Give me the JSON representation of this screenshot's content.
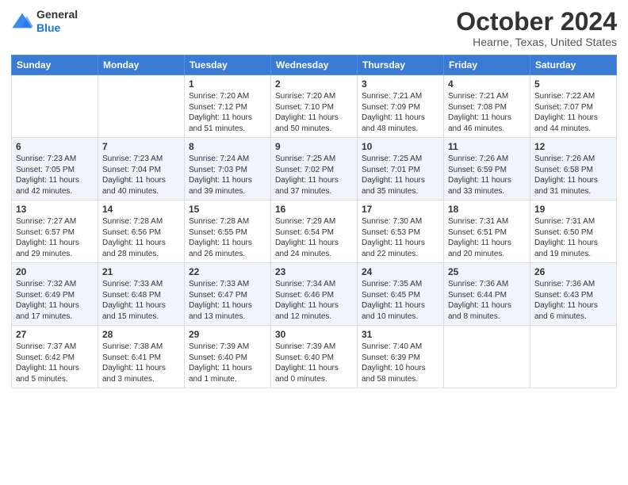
{
  "header": {
    "logo": {
      "general": "General",
      "blue": "Blue"
    },
    "title": "October 2024",
    "subtitle": "Hearne, Texas, United States"
  },
  "calendar": {
    "days_of_week": [
      "Sunday",
      "Monday",
      "Tuesday",
      "Wednesday",
      "Thursday",
      "Friday",
      "Saturday"
    ],
    "weeks": [
      [
        {
          "day": "",
          "sunrise": "",
          "sunset": "",
          "daylight": ""
        },
        {
          "day": "",
          "sunrise": "",
          "sunset": "",
          "daylight": ""
        },
        {
          "day": "1",
          "sunrise": "Sunrise: 7:20 AM",
          "sunset": "Sunset: 7:12 PM",
          "daylight": "Daylight: 11 hours and 51 minutes."
        },
        {
          "day": "2",
          "sunrise": "Sunrise: 7:20 AM",
          "sunset": "Sunset: 7:10 PM",
          "daylight": "Daylight: 11 hours and 50 minutes."
        },
        {
          "day": "3",
          "sunrise": "Sunrise: 7:21 AM",
          "sunset": "Sunset: 7:09 PM",
          "daylight": "Daylight: 11 hours and 48 minutes."
        },
        {
          "day": "4",
          "sunrise": "Sunrise: 7:21 AM",
          "sunset": "Sunset: 7:08 PM",
          "daylight": "Daylight: 11 hours and 46 minutes."
        },
        {
          "day": "5",
          "sunrise": "Sunrise: 7:22 AM",
          "sunset": "Sunset: 7:07 PM",
          "daylight": "Daylight: 11 hours and 44 minutes."
        }
      ],
      [
        {
          "day": "6",
          "sunrise": "Sunrise: 7:23 AM",
          "sunset": "Sunset: 7:05 PM",
          "daylight": "Daylight: 11 hours and 42 minutes."
        },
        {
          "day": "7",
          "sunrise": "Sunrise: 7:23 AM",
          "sunset": "Sunset: 7:04 PM",
          "daylight": "Daylight: 11 hours and 40 minutes."
        },
        {
          "day": "8",
          "sunrise": "Sunrise: 7:24 AM",
          "sunset": "Sunset: 7:03 PM",
          "daylight": "Daylight: 11 hours and 39 minutes."
        },
        {
          "day": "9",
          "sunrise": "Sunrise: 7:25 AM",
          "sunset": "Sunset: 7:02 PM",
          "daylight": "Daylight: 11 hours and 37 minutes."
        },
        {
          "day": "10",
          "sunrise": "Sunrise: 7:25 AM",
          "sunset": "Sunset: 7:01 PM",
          "daylight": "Daylight: 11 hours and 35 minutes."
        },
        {
          "day": "11",
          "sunrise": "Sunrise: 7:26 AM",
          "sunset": "Sunset: 6:59 PM",
          "daylight": "Daylight: 11 hours and 33 minutes."
        },
        {
          "day": "12",
          "sunrise": "Sunrise: 7:26 AM",
          "sunset": "Sunset: 6:58 PM",
          "daylight": "Daylight: 11 hours and 31 minutes."
        }
      ],
      [
        {
          "day": "13",
          "sunrise": "Sunrise: 7:27 AM",
          "sunset": "Sunset: 6:57 PM",
          "daylight": "Daylight: 11 hours and 29 minutes."
        },
        {
          "day": "14",
          "sunrise": "Sunrise: 7:28 AM",
          "sunset": "Sunset: 6:56 PM",
          "daylight": "Daylight: 11 hours and 28 minutes."
        },
        {
          "day": "15",
          "sunrise": "Sunrise: 7:28 AM",
          "sunset": "Sunset: 6:55 PM",
          "daylight": "Daylight: 11 hours and 26 minutes."
        },
        {
          "day": "16",
          "sunrise": "Sunrise: 7:29 AM",
          "sunset": "Sunset: 6:54 PM",
          "daylight": "Daylight: 11 hours and 24 minutes."
        },
        {
          "day": "17",
          "sunrise": "Sunrise: 7:30 AM",
          "sunset": "Sunset: 6:53 PM",
          "daylight": "Daylight: 11 hours and 22 minutes."
        },
        {
          "day": "18",
          "sunrise": "Sunrise: 7:31 AM",
          "sunset": "Sunset: 6:51 PM",
          "daylight": "Daylight: 11 hours and 20 minutes."
        },
        {
          "day": "19",
          "sunrise": "Sunrise: 7:31 AM",
          "sunset": "Sunset: 6:50 PM",
          "daylight": "Daylight: 11 hours and 19 minutes."
        }
      ],
      [
        {
          "day": "20",
          "sunrise": "Sunrise: 7:32 AM",
          "sunset": "Sunset: 6:49 PM",
          "daylight": "Daylight: 11 hours and 17 minutes."
        },
        {
          "day": "21",
          "sunrise": "Sunrise: 7:33 AM",
          "sunset": "Sunset: 6:48 PM",
          "daylight": "Daylight: 11 hours and 15 minutes."
        },
        {
          "day": "22",
          "sunrise": "Sunrise: 7:33 AM",
          "sunset": "Sunset: 6:47 PM",
          "daylight": "Daylight: 11 hours and 13 minutes."
        },
        {
          "day": "23",
          "sunrise": "Sunrise: 7:34 AM",
          "sunset": "Sunset: 6:46 PM",
          "daylight": "Daylight: 11 hours and 12 minutes."
        },
        {
          "day": "24",
          "sunrise": "Sunrise: 7:35 AM",
          "sunset": "Sunset: 6:45 PM",
          "daylight": "Daylight: 11 hours and 10 minutes."
        },
        {
          "day": "25",
          "sunrise": "Sunrise: 7:36 AM",
          "sunset": "Sunset: 6:44 PM",
          "daylight": "Daylight: 11 hours and 8 minutes."
        },
        {
          "day": "26",
          "sunrise": "Sunrise: 7:36 AM",
          "sunset": "Sunset: 6:43 PM",
          "daylight": "Daylight: 11 hours and 6 minutes."
        }
      ],
      [
        {
          "day": "27",
          "sunrise": "Sunrise: 7:37 AM",
          "sunset": "Sunset: 6:42 PM",
          "daylight": "Daylight: 11 hours and 5 minutes."
        },
        {
          "day": "28",
          "sunrise": "Sunrise: 7:38 AM",
          "sunset": "Sunset: 6:41 PM",
          "daylight": "Daylight: 11 hours and 3 minutes."
        },
        {
          "day": "29",
          "sunrise": "Sunrise: 7:39 AM",
          "sunset": "Sunset: 6:40 PM",
          "daylight": "Daylight: 11 hours and 1 minute."
        },
        {
          "day": "30",
          "sunrise": "Sunrise: 7:39 AM",
          "sunset": "Sunset: 6:40 PM",
          "daylight": "Daylight: 11 hours and 0 minutes."
        },
        {
          "day": "31",
          "sunrise": "Sunrise: 7:40 AM",
          "sunset": "Sunset: 6:39 PM",
          "daylight": "Daylight: 10 hours and 58 minutes."
        },
        {
          "day": "",
          "sunrise": "",
          "sunset": "",
          "daylight": ""
        },
        {
          "day": "",
          "sunrise": "",
          "sunset": "",
          "daylight": ""
        }
      ]
    ]
  }
}
